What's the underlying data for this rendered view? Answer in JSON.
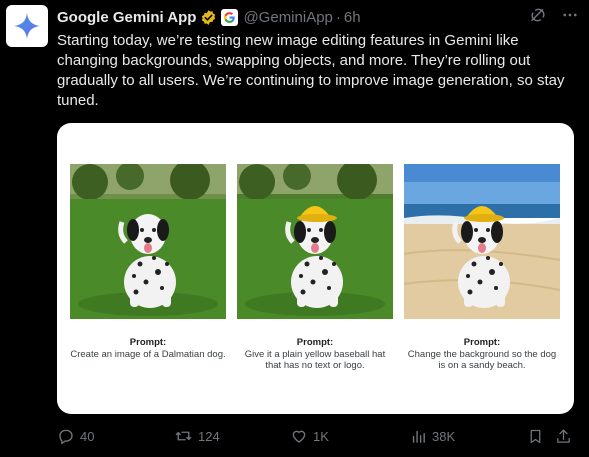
{
  "tweet": {
    "display_name": "Google Gemini App",
    "handle": "@GeminiApp",
    "separator": "·",
    "time": "6h",
    "text": "Starting today, we’re testing new image editing features in Gemini like changing backgrounds, swapping objects, and more. They’re rolling out gradually to all users. We’re continuing to improve image generation, so stay tuned."
  },
  "media": {
    "panels": [
      {
        "prompt_label": "Prompt:",
        "prompt_text": "Create an image of a Dalmatian dog.",
        "scene": "grass"
      },
      {
        "prompt_label": "Prompt:",
        "prompt_text": "Give it a plain yellow baseball hat that has no text or logo.",
        "scene": "grass-hat"
      },
      {
        "prompt_label": "Prompt:",
        "prompt_text": "Change the background so the dog is on a sandy beach.",
        "scene": "beach-hat"
      }
    ]
  },
  "actions": {
    "replies": "40",
    "reposts": "124",
    "likes": "1K",
    "views": "38K"
  },
  "icons": {
    "verified": "verified-badge-icon",
    "affiliate": "google-g-logo",
    "grok": "grok-icon",
    "more": "more-icon",
    "reply": "reply-icon",
    "repost": "repost-icon",
    "like": "heart-icon",
    "views": "views-icon",
    "bookmark": "bookmark-icon",
    "share": "share-icon"
  },
  "colors": {
    "background": "#000000",
    "text": "#e7e9ea",
    "muted": "#71767b",
    "verified_gold": "#e2b719",
    "hat_yellow": "#f5c518"
  }
}
